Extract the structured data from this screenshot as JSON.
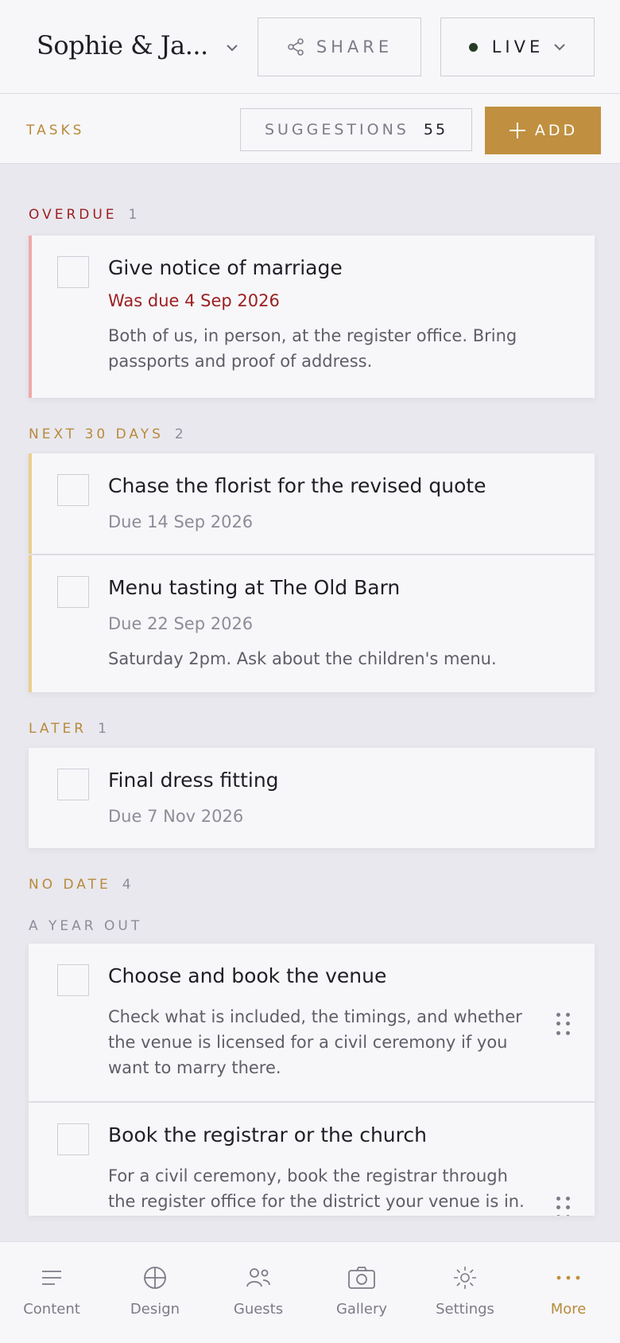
{
  "header": {
    "couple_name": "Sophie & Ja...",
    "share_label": "SHARE",
    "live_label": "LIVE"
  },
  "subheader": {
    "tasks_label": "TASKS",
    "suggestions_label": "SUGGESTIONS",
    "suggestions_count": "55",
    "add_label": "ADD"
  },
  "sections": {
    "overdue": {
      "label": "OVERDUE",
      "count": "1"
    },
    "next30": {
      "label": "NEXT 30 DAYS",
      "count": "2"
    },
    "later": {
      "label": "LATER",
      "count": "1"
    },
    "nodate": {
      "label": "NO DATE",
      "count": "4"
    },
    "year_out": {
      "label": "A YEAR OUT"
    }
  },
  "tasks": {
    "notice": {
      "title": "Give notice of marriage",
      "due": "Was due 4 Sep 2026",
      "note": "Both of us, in person, at the register office. Bring passports and proof of address."
    },
    "florist": {
      "title": "Chase the florist for the revised quote",
      "due": "Due 14 Sep 2026"
    },
    "tasting": {
      "title": "Menu tasting at The Old Barn",
      "due": "Due 22 Sep 2026",
      "note": "Saturday 2pm. Ask about the children's menu."
    },
    "dress": {
      "title": "Final dress fitting",
      "due": "Due 7 Nov 2026"
    },
    "venue": {
      "title": "Choose and book the venue",
      "note": "Check what is included, the timings, and whether the venue is licensed for a civil ceremony if you want to marry there."
    },
    "registrar": {
      "title": "Book the registrar or the church",
      "note": "For a civil ceremony, book the registrar through the register office for the district your venue is in."
    }
  },
  "nav": {
    "content": "Content",
    "design": "Design",
    "guests": "Guests",
    "gallery": "Gallery",
    "settings": "Settings",
    "more": "More"
  },
  "colors": {
    "accent_gold": "#c09040",
    "overdue_red": "#9c1f22",
    "overdue_bar": "#f0aaa6",
    "upcoming_bar": "#ebcf8a",
    "background": "#e9e8ee"
  },
  "icons": [
    "chevron-down-icon",
    "share-icon",
    "plus-icon",
    "drag-handle-icon",
    "lines-icon",
    "globe-icon",
    "people-icon",
    "camera-icon",
    "sun-icon",
    "dots-icon"
  ]
}
